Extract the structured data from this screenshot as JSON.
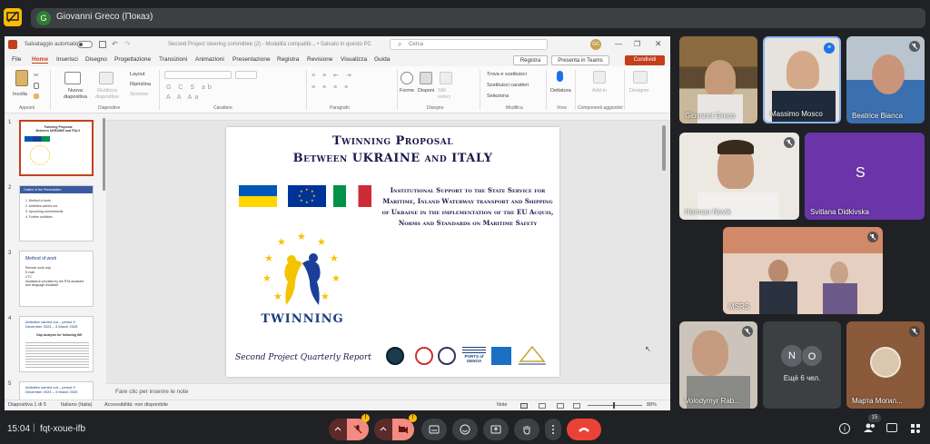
{
  "meeting": {
    "presenter_initial": "G",
    "presenter_label": "Giovanni Greco (Показ)",
    "time": "15:04",
    "code": "fqt-xoue-ifb",
    "people_count": "15",
    "more_people_label": "Ещё 6 чел."
  },
  "ppt": {
    "autosave_label": "Salvataggio automatico",
    "doc_title": "Second Project steering committee (2) - Modalità compatibi... • Salvato in questo PC",
    "search_placeholder": "Cerca",
    "user_initials": "GG",
    "menu": [
      "File",
      "Home",
      "Inserisci",
      "Disegno",
      "Progettazione",
      "Transizioni",
      "Animazioni",
      "Presentazione",
      "Registra",
      "Revisione",
      "Visualizza",
      "Guida"
    ],
    "active_menu": "Home",
    "record_button": "Registra",
    "teams_button": "Presenta in Teams",
    "share_button": "Condividi",
    "ribbon": {
      "paste": "Incolla",
      "new_slide": "Nuova diapositiva",
      "reuse": "Riutilizza diapositive",
      "layout": "Layout",
      "reset": "Ripristina",
      "section": "Sezione",
      "shapes": "Forme",
      "arrange": "Disponi",
      "quick_styles": "Stili veloci",
      "find": "Trova e sostituisci",
      "replace_fonts": "Sostituisci caratteri",
      "select": "Seleziona",
      "dictate": "Dettatura",
      "addins": "Add-in",
      "designer": "Designer",
      "groups": [
        "Appunti",
        "Diapositive",
        "Carattere",
        "Paragrafo",
        "Disegno",
        "Modifica",
        "Voce",
        "Componenti aggiuntivi"
      ]
    },
    "thumbnails": [
      {
        "num": "1",
        "title": "Twinning Proposal\nBetween UKRAINE and ITALY"
      },
      {
        "num": "2",
        "title": "Outline of the Presentation",
        "lines": [
          "1. Method of work",
          "2. Activities carried out",
          "3. Upcoming commitments",
          "4. Further activities"
        ]
      },
      {
        "num": "3",
        "title": "Method of work",
        "lines": [
          "Remote work only",
          "E-mail",
          "VTC",
          "Assistance provided by the RTA assistant and language Assistant"
        ]
      },
      {
        "num": "4",
        "title": "Activities carried out – period 9 December 2024 – 3 March 2025",
        "sub": "Gap Analysis for following IMI"
      },
      {
        "num": "5",
        "title": "Activities carried out – period 9 December 2024 – 3 March 2025"
      }
    ],
    "slide": {
      "title_line1": "Twinning Proposal",
      "title_line2": "Between UKRAINE and ITALY",
      "body": "Institutional Support to the State Service for Maritime, Inland Waterway transport and Shipping of Ukraine in the implementation of the EU Acquis, Norms and Standards on Maritime Safety",
      "logo_text": "TWINNING",
      "footer": "Second Project Quarterly Report",
      "footer_logo_label": "PORTS of GENOA"
    },
    "notes_placeholder": "Fare clic per inserire le note",
    "status": {
      "slide_of": "Diapositiva 1 di 5",
      "language": "Italiano (Italia)",
      "accessibility": "Accessibilità: non disponibile",
      "notes": "Note",
      "zoom": "88%"
    }
  },
  "participants": [
    {
      "name": "Giovanni Greco",
      "muted": false
    },
    {
      "name": "Massimo Mosco",
      "muted": false,
      "speaking": true
    },
    {
      "name": "Beatrice Bianca",
      "muted": true
    },
    {
      "name": "Herman Novik",
      "muted": true
    },
    {
      "name": "Svitlana Didkivska",
      "initial": "S",
      "muted": false
    },
    {
      "name": "MSRS",
      "muted": true
    },
    {
      "name": "Volodymyr Rab...",
      "muted": true
    },
    {
      "name": "Марта Могил...",
      "muted": true
    }
  ],
  "more_tile_initials": [
    "N",
    "O"
  ],
  "colors": {
    "accent_orange": "#c43e1c",
    "meet_red": "#ea4335",
    "tile_purple": "#6a35a8",
    "brown_tile": "#8a5a3a"
  }
}
